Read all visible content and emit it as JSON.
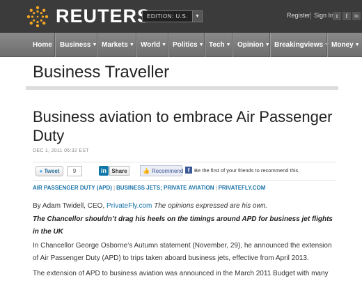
{
  "header": {
    "brand": "REUTERS",
    "edition_label": "EDITION: U.S.",
    "register": "Register",
    "sign_in": "Sign In",
    "social": [
      "t",
      "f",
      "in"
    ]
  },
  "nav": {
    "items": [
      {
        "label": "Home"
      },
      {
        "label": "Business"
      },
      {
        "label": "Markets"
      },
      {
        "label": "World"
      },
      {
        "label": "Politics"
      },
      {
        "label": "Tech"
      },
      {
        "label": "Opinion"
      },
      {
        "label": "Breakingviews"
      },
      {
        "label": "Money"
      }
    ]
  },
  "section": {
    "title": "Business Traveller"
  },
  "article": {
    "headline": "Business aviation to embrace Air Passenger Duty",
    "dateline": "DEC 1, 2011 06:32 EST",
    "share": {
      "tweet_label": "Tweet",
      "tweet_count": "9",
      "linkedin_icon": "in",
      "share_label": "Share",
      "recommend_label": "Recommend",
      "facebook_text": "Be the first of your friends to recommend this."
    },
    "tags": [
      "AIR PASSENGER DUTY (APD)",
      "BUSINESS JETS; PRIVATE AVIATION",
      "PRIVATEFLY.COM"
    ],
    "byline_prefix": "By Adam Twidell, CEO, ",
    "byline_link": "PrivateFly.com",
    "byline_suffix": " The opinions expressed are his own.",
    "lead": "The Chancellor shouldn’t drag his heels on the timings around APD for business jet flights in the UK",
    "para1": "In Chancellor George Osborne’s Autumn statement (November, 29), he announced the extension of Air Passenger Duty (APD) to trips taken aboard business jets, effective from April 2013.",
    "para2": "The extension of APD to business aviation was announced in the March 2011 Budget with many"
  },
  "colors": {
    "topbar": "#3b3b3b",
    "nav": "#7b7b7b",
    "link": "#1a73a8",
    "logo": "#f5a623"
  }
}
